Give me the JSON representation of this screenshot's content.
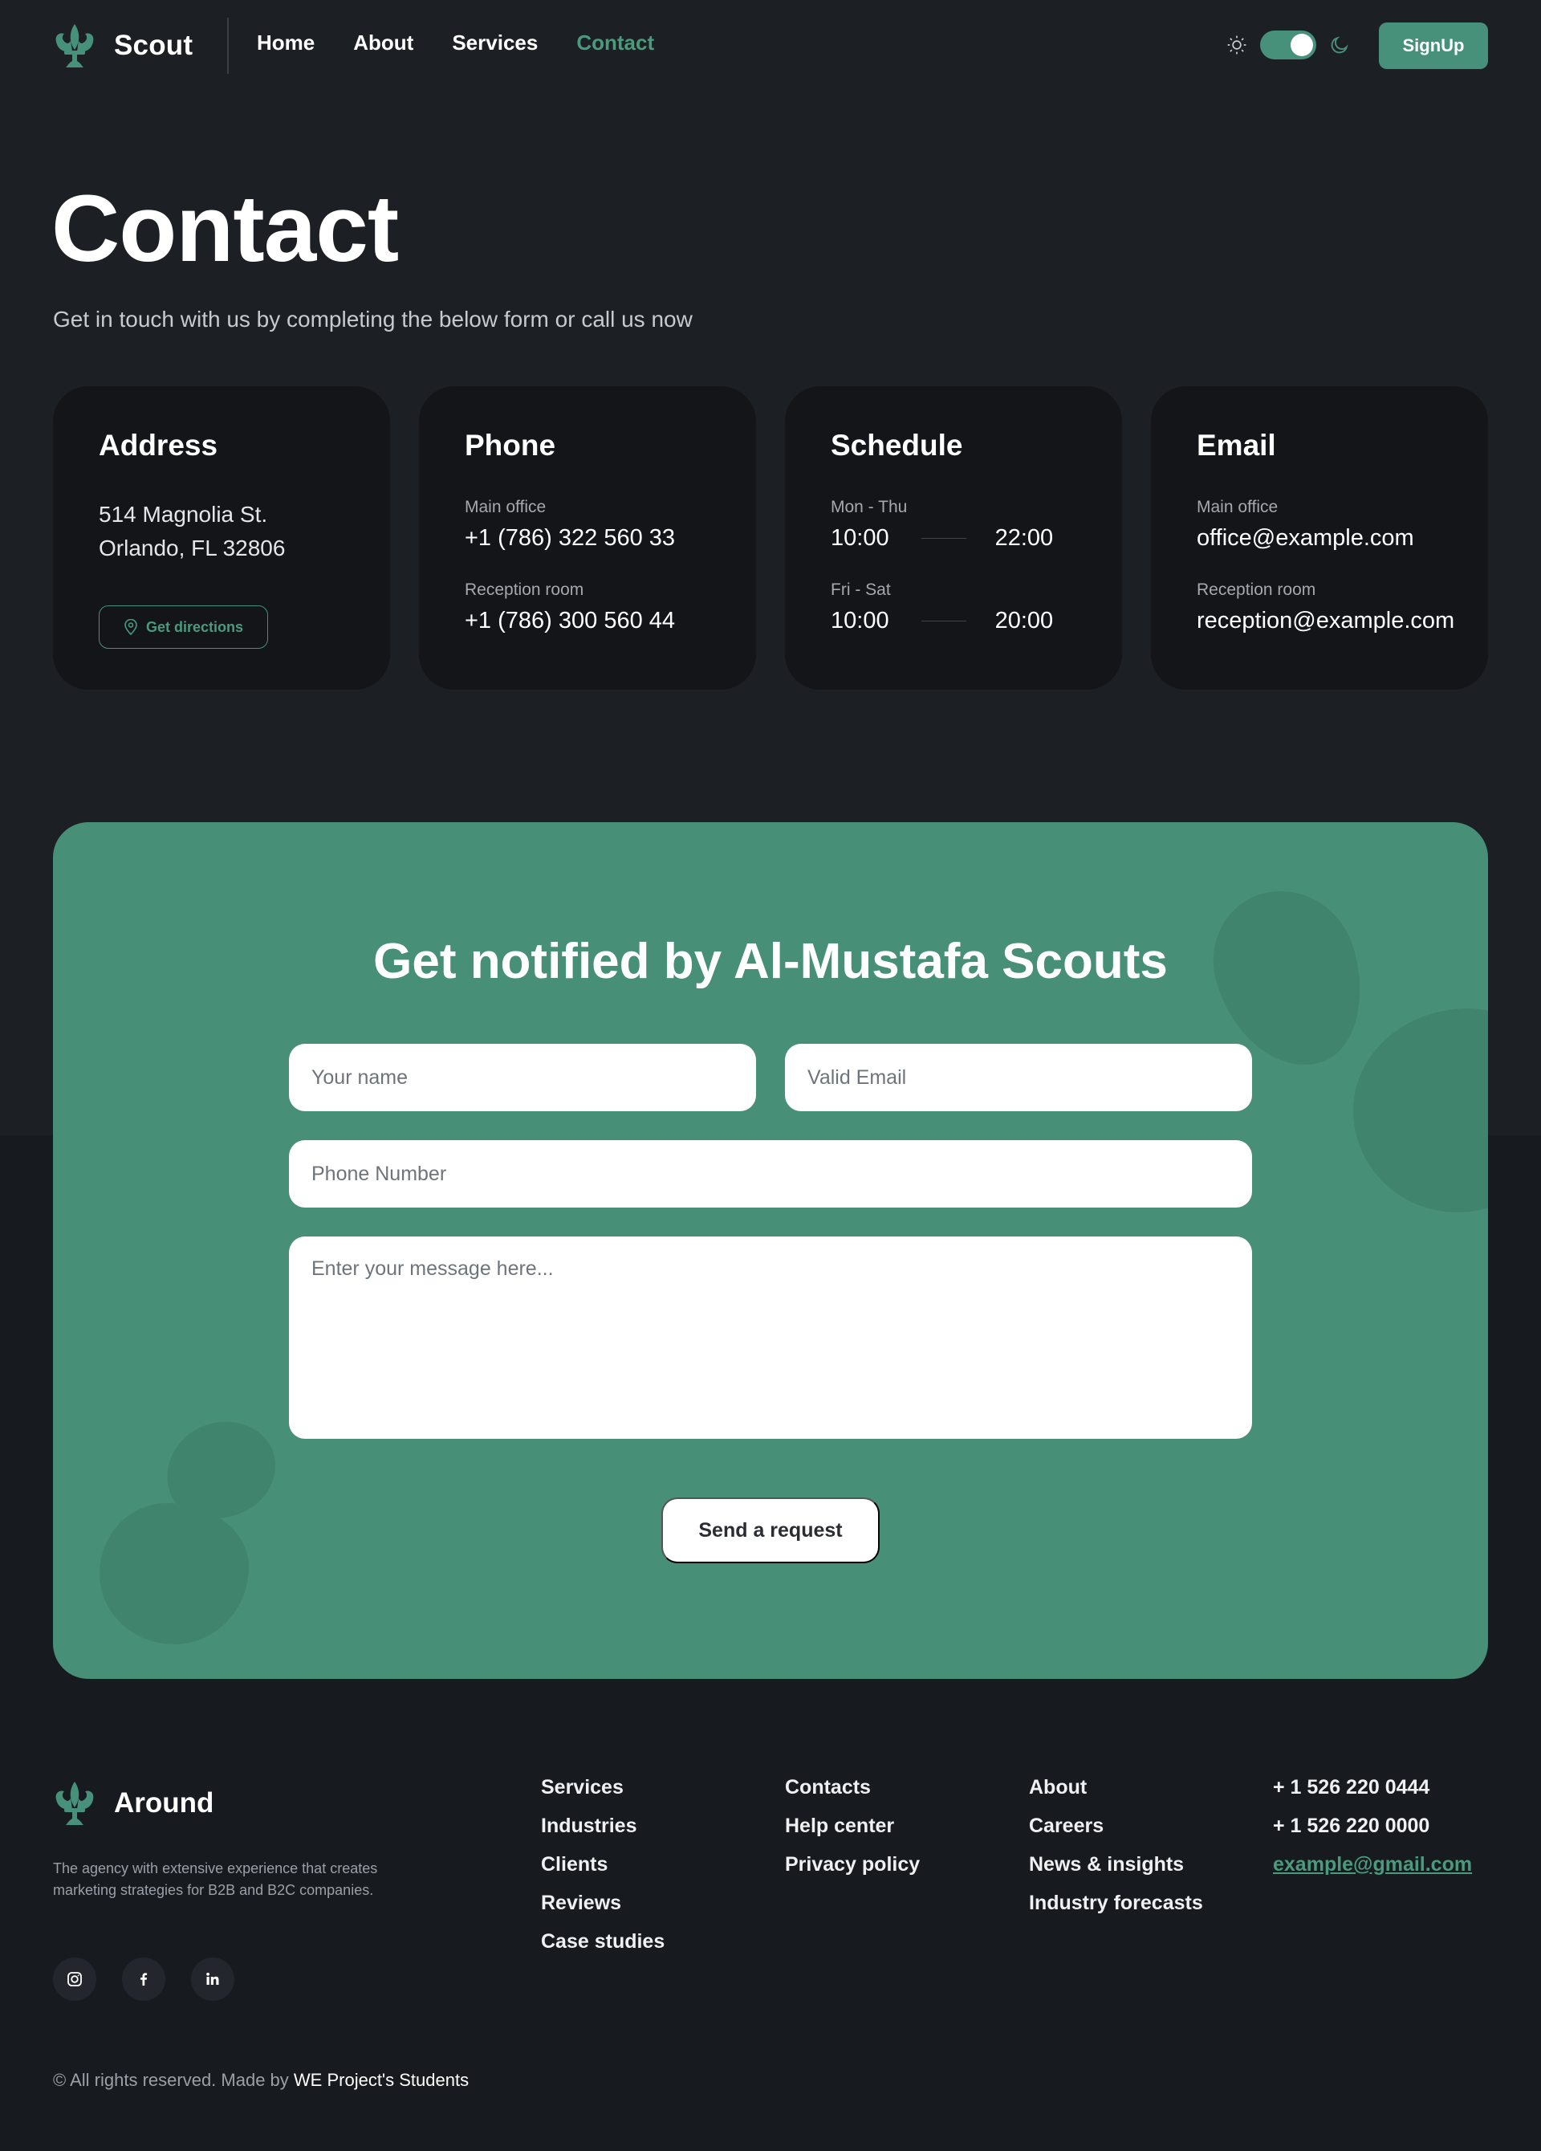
{
  "nav": {
    "brand": "Scout",
    "links": [
      "Home",
      "About",
      "Services",
      "Contact"
    ],
    "active_link": "Contact",
    "theme_icons": [
      "sun-icon",
      "moon-icon"
    ],
    "signup_label": "SignUp"
  },
  "hero": {
    "title": "Contact",
    "subtitle": "Get in touch with us by completing the below form or call us now"
  },
  "cards": {
    "address": {
      "title": "Address",
      "line1": "514 Magnolia St.",
      "line2": "Orlando, FL 32806",
      "button": "Get directions"
    },
    "phone": {
      "title": "Phone",
      "entries": [
        {
          "label": "Main office",
          "value": "+1 (786) 322 560 33"
        },
        {
          "label": "Reception room",
          "value": "+1 (786) 300 560 44"
        }
      ]
    },
    "schedule": {
      "title": "Schedule",
      "entries": [
        {
          "label": "Mon - Thu",
          "open": "10:00",
          "close": "22:00"
        },
        {
          "label": "Fri - Sat",
          "open": "10:00",
          "close": "20:00"
        }
      ]
    },
    "email": {
      "title": "Email",
      "entries": [
        {
          "label": "Main office",
          "value": "office@example.com"
        },
        {
          "label": "Reception room",
          "value": "reception@example.com"
        }
      ]
    }
  },
  "form": {
    "title": "Get notified by Al-Mustafa Scouts",
    "name_placeholder": "Your name",
    "email_placeholder": "Valid Email",
    "phone_placeholder": "Phone Number",
    "message_placeholder": "Enter your message here...",
    "submit_label": "Send a request"
  },
  "footer": {
    "brand": "Around",
    "description": "The agency with extensive experience that creates marketing strategies for B2B and B2C companies.",
    "socials": [
      "instagram-icon",
      "facebook-icon",
      "linkedin-icon"
    ],
    "col1": [
      "Services",
      "Industries",
      "Clients",
      "Reviews",
      "Case studies"
    ],
    "col2": [
      "Contacts",
      "Help center",
      "Privacy policy"
    ],
    "col3": [
      "About",
      "Careers",
      "News & insights",
      "Industry forecasts"
    ],
    "contact": {
      "phone1": "+ 1 526 220 0444",
      "phone2": "+ 1 526 220 0000",
      "email": "example@gmail.com"
    },
    "copyright_prefix": "© All rights reserved. Made by",
    "copyright_author": "WE Project's Students"
  },
  "colors": {
    "accent": "#47917a",
    "background": "#1c1f24",
    "card": "#131519"
  }
}
